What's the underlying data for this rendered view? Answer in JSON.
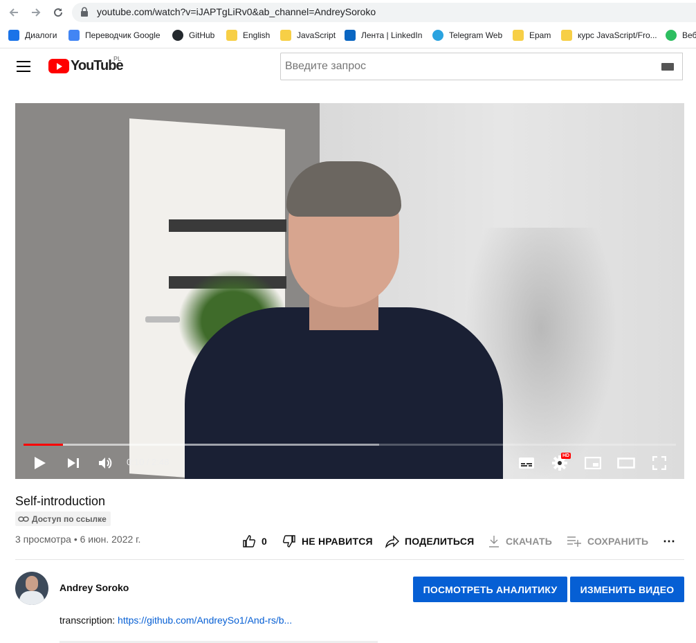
{
  "browser": {
    "url": "youtube.com/watch?v=iJAPTgLiRv0&ab_channel=AndreySoroko",
    "bookmarks": [
      {
        "label": "Диалоги",
        "icon": "chat-icon",
        "color": "#1a73e8"
      },
      {
        "label": "Переводчик Google",
        "icon": "translate-icon",
        "color": "#4285f4"
      },
      {
        "label": "GitHub",
        "icon": "github-icon",
        "color": "#24292e"
      },
      {
        "label": "English",
        "icon": "folder-icon",
        "color": "#f7cf46"
      },
      {
        "label": "JavaScript",
        "icon": "folder-icon",
        "color": "#f7cf46"
      },
      {
        "label": "Лента | LinkedIn",
        "icon": "linkedin-icon",
        "color": "#0a66c2"
      },
      {
        "label": "Telegram Web",
        "icon": "telegram-icon",
        "color": "#2aa3e0"
      },
      {
        "label": "Epam",
        "icon": "folder-icon",
        "color": "#f7cf46"
      },
      {
        "label": "курс JavaScript/Fro...",
        "icon": "folder-icon",
        "color": "#f7cf46"
      },
      {
        "label": "Веб",
        "icon": "evernote-icon",
        "color": "#2dbe60"
      }
    ]
  },
  "youtube": {
    "logo_text": "YouTube",
    "country_code": "PL",
    "search_placeholder": "Введите запрос",
    "brand_color": "#ff0000"
  },
  "player": {
    "time": "0:10 / 2:48",
    "progress": 0.06,
    "buffered": 0.545,
    "hd_badge": "HD"
  },
  "video": {
    "title": "Self-introduction",
    "visibility": "Доступ по ссылке",
    "views": "3 просмотра",
    "date": "6 июн. 2022 г.",
    "separator": "•",
    "likes": "0",
    "dislike_label": "НЕ НРАВИТСЯ",
    "share_label": "ПОДЕЛИТЬСЯ",
    "download_label": "СКАЧАТЬ",
    "save_label": "СОХРАНИТЬ",
    "more": "⋯"
  },
  "channel": {
    "name": "Andrey Soroko",
    "analytics_button": "ПОСМОТРЕТЬ АНАЛИТИКУ",
    "edit_button": "ИЗМЕНИТЬ ВИДЕО",
    "button_color": "#065fd4"
  },
  "description": {
    "label": "transcription: ",
    "link": "https://github.com/AndreySo1/And-rs/b..."
  }
}
